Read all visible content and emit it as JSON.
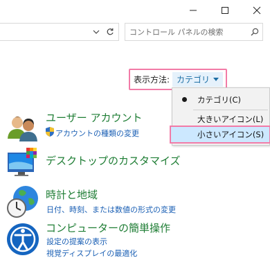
{
  "window_controls": {
    "minimize_icon": "minimize-icon",
    "maximize_icon": "maximize-icon",
    "close_icon": "close-icon"
  },
  "search": {
    "placeholder": "コントロール パネルの検索",
    "icon": "search-icon"
  },
  "view_by": {
    "label": "表示方法:",
    "selected": "カテゴリ"
  },
  "view_menu": {
    "options": [
      "カテゴリ(C)",
      "大きいアイコン(L)",
      "小さいアイコン(S)"
    ],
    "checked_index": 0,
    "highlighted_index": 2
  },
  "categories": [
    {
      "title": "ユーザー アカウント",
      "links": [
        "アカウントの種類の変更"
      ]
    },
    {
      "title": "デスクトップのカスタマイズ",
      "links": []
    },
    {
      "title": "時計と地域",
      "links": [
        "日付、時刻、または数値の形式の変更"
      ]
    },
    {
      "title": "コンピューターの簡単操作",
      "links": [
        "設定の提案の表示",
        "視覚ディスプレイの最適化"
      ]
    }
  ],
  "colors": {
    "highlight_border": "#f27ba7",
    "category_title": "#1e7d34",
    "link": "#1a5fb4",
    "selected_menu_bg": "#cce8ff"
  }
}
